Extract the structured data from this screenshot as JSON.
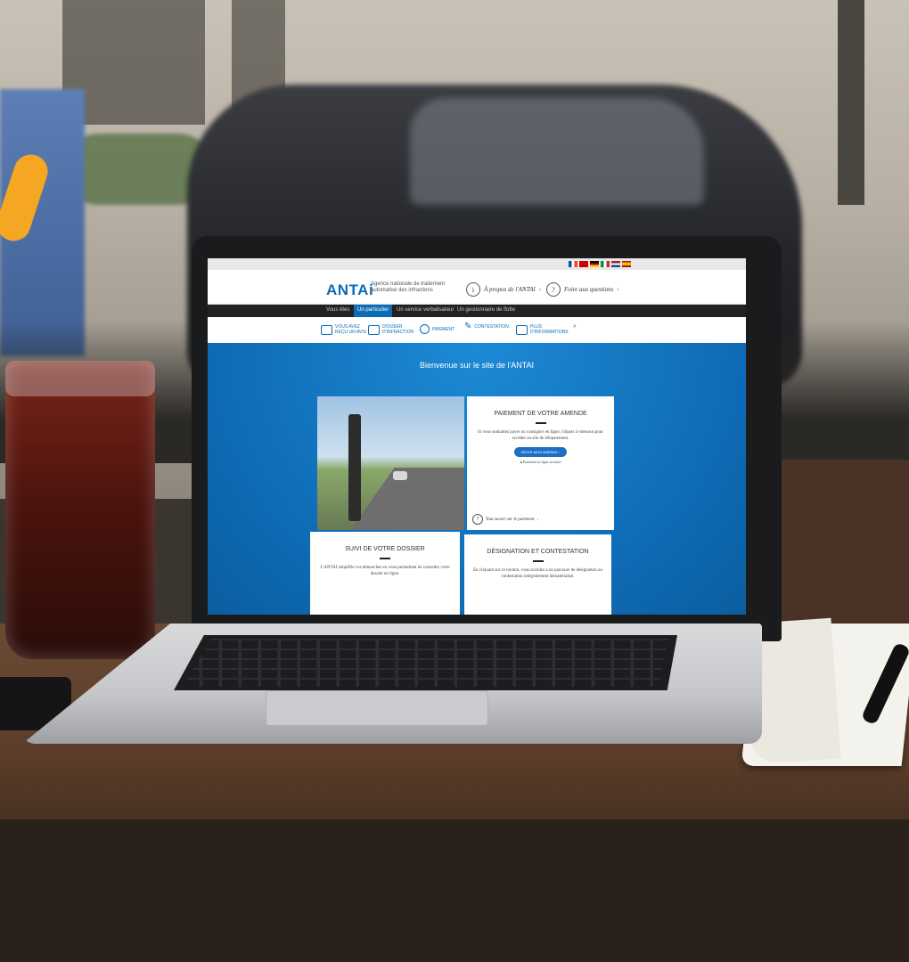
{
  "site": {
    "logo": "ANTAi",
    "logo_subtitle": "Agence nationale de traitement automatisé des infractions",
    "header_links": [
      {
        "label": "À propos de l'ANTAI",
        "icon": "info-circle-icon"
      },
      {
        "label": "Foire aux questions",
        "icon": "question-circle-icon"
      }
    ],
    "flag_colors": [
      "#0055a4",
      "#ffffff",
      "#ef4135",
      "#cc0000",
      "#000000",
      "#ffce00",
      "#21468b",
      "#ae1c28",
      "#aa151b",
      "#f1bf00"
    ]
  },
  "navbar": {
    "items": [
      "Vous êtes",
      "Un particulier",
      "Un service verbalisateur",
      "Un gestionnaire de flotte"
    ],
    "active_index": 1
  },
  "subnav": {
    "items": [
      {
        "label": "VOUS AVEZ REÇU UN AVIS",
        "icon": "envelope-icon"
      },
      {
        "label": "DOSSIER D'INFRACTION",
        "icon": "folder-icon"
      },
      {
        "label": "PAIEMENT",
        "icon": "euro-icon"
      },
      {
        "label": "CONTESTATION",
        "icon": "pen-icon"
      },
      {
        "label": "PLUS D'INFORMATIONS",
        "icon": "info-icon"
      }
    ],
    "search_icon": "search-icon"
  },
  "hero": {
    "welcome": "Bienvenue sur le site de l'ANTAI"
  },
  "cards": {
    "payment": {
      "title": "PAIEMENT DE VOTRE AMENDE",
      "body": "Si vous souhaitez payer ou consigner en ligne, cliquez ci-dessous pour accéder au site de télépaiement.",
      "button": "PAYER MON AMENDE",
      "secure": "Paiement en ligne sécurisé",
      "footer_link": "Tout savoir sur le paiement"
    },
    "dossier": {
      "title": "SUIVI DE VOTRE DOSSIER",
      "body": "L'ANTAI simplifie vos démarches en vous permettant de consulter votre dossier en ligne."
    },
    "designation": {
      "title": "DÉSIGNATION ET CONTESTATION",
      "body": "En cliquant sur ce bouton, vous accédez à un parcours de désignation ou contestation intégralement dématérialisé."
    }
  }
}
